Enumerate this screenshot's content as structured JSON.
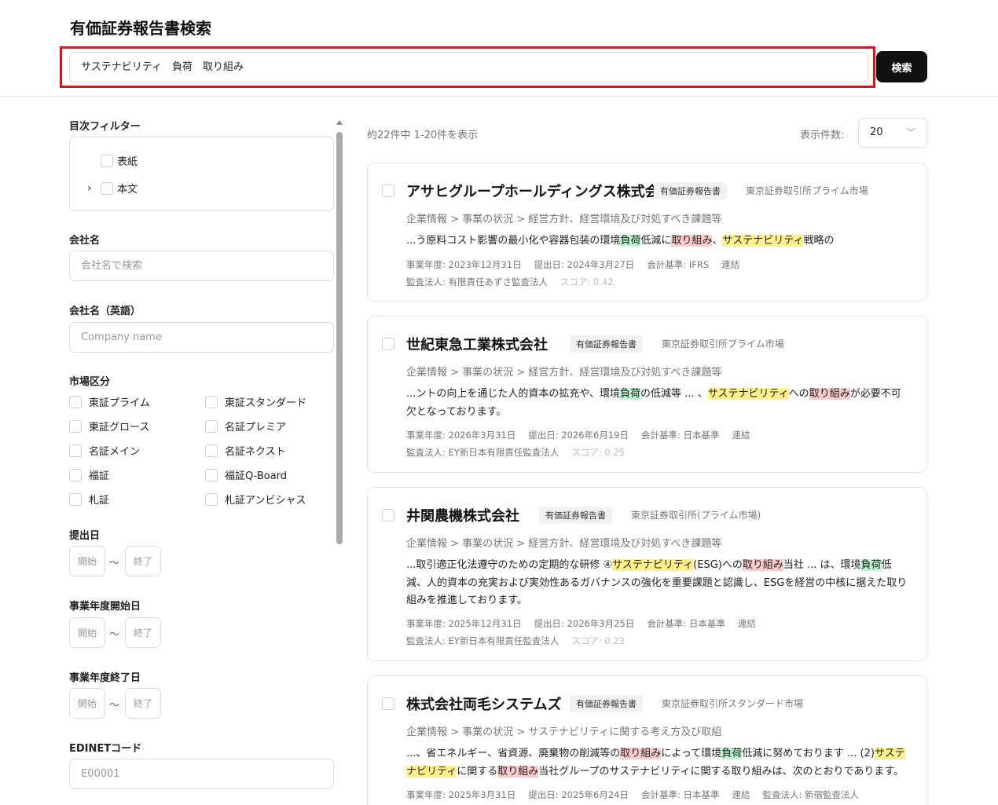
{
  "header": {
    "title": "有価証券報告書検索",
    "search_value": "サステナビリティ　負荷　取り組み",
    "search_button": "検索"
  },
  "sidebar": {
    "toc_filter": {
      "label": "目次フィルター",
      "items": [
        "表紙",
        "本文"
      ]
    },
    "company_name": {
      "label": "会社名",
      "placeholder": "会社名で検索"
    },
    "company_name_en": {
      "label": "会社名（英語）",
      "placeholder": "Company name"
    },
    "market": {
      "label": "市場区分",
      "options": [
        "東証プライム",
        "東証スタンダード",
        "東証グロース",
        "名証プレミア",
        "名証メイン",
        "名証ネクスト",
        "福証",
        "福証Q-Board",
        "札証",
        "札証アンビシャス"
      ]
    },
    "submit_date": {
      "label": "提出日",
      "start": "開始",
      "sep": "〜",
      "end": "終了"
    },
    "fy_start": {
      "label": "事業年度開始日",
      "start": "開始",
      "sep": "〜",
      "end": "終了"
    },
    "fy_end": {
      "label": "事業年度終了日",
      "start": "開始",
      "sep": "〜",
      "end": "終了"
    },
    "edinet": {
      "label": "EDINETコード",
      "placeholder": "E00001"
    }
  },
  "results": {
    "count_text": "約22件中 1-20件を表示",
    "per_page_label": "表示件数:",
    "per_page_value": "20",
    "cards": [
      {
        "name": "アサヒグループホールディングス株式会社",
        "doc_type": "有価証券報告書",
        "market": "東京証券取引所プライム市場",
        "crumb": "企業情報 > 事業の状況 > 経営方針、経営環境及び対処すべき課題等",
        "snippet": [
          [
            "...う原料コスト影響の最小化や容器包装の環境",
            ""
          ],
          [
            "負荷",
            "g"
          ],
          [
            "低減に",
            ""
          ],
          [
            "取り組み",
            "r"
          ],
          [
            "、",
            ""
          ],
          [
            "サステナビリティ",
            "y"
          ],
          [
            "戦略の",
            ""
          ]
        ],
        "fy": "事業年度: 2023年12月31日",
        "submitted": "提出日: 2024年3月27日",
        "standard": "会計基準: IFRS",
        "consolidated": "連結",
        "auditor": "監査法人: 有限責任あずさ監査法人",
        "score": "スコア: 0.42"
      },
      {
        "name": "世紀東急工業株式会社",
        "doc_type": "有価証券報告書",
        "market": "東京証券取引所プライム市場",
        "crumb": "企業情報 > 事業の状況 > 経営方針、経営環境及び対処すべき課題等",
        "snippet": [
          [
            "...ントの向上を通じた人的資本の拡充や、環境",
            ""
          ],
          [
            "負荷",
            "g"
          ],
          [
            "の低減等 ... 、",
            ""
          ],
          [
            "サステナビリティ",
            "y"
          ],
          [
            "への",
            ""
          ],
          [
            "取り組み",
            "r"
          ],
          [
            "が必要不可欠となっております。",
            ""
          ]
        ],
        "fy": "事業年度: 2026年3月31日",
        "submitted": "提出日: 2026年6月19日",
        "standard": "会計基準: 日本基準",
        "consolidated": "連結",
        "auditor": "監査法人: EY新日本有限責任監査法人",
        "score": "スコア: 0.25"
      },
      {
        "name": "井関農機株式会社",
        "doc_type": "有価証券報告書",
        "market": "東京証券取引所(プライム市場)",
        "crumb": "企業情報 > 事業の状況 > 経営方針、経営環境及び対処すべき課題等",
        "snippet": [
          [
            "...取引適正化法遵守のための定期的な研修 ④",
            ""
          ],
          [
            "サステナビリティ",
            "y"
          ],
          [
            "(ESG)への",
            ""
          ],
          [
            "取り組み",
            "r"
          ],
          [
            "当社 ... は、環境",
            ""
          ],
          [
            "負荷",
            "g"
          ],
          [
            "低減、人的資本の充実および実効性あるガバナンスの強化を重要課題と認識し、ESGを経営の中核に据えた取り組みを推進しております。",
            ""
          ]
        ],
        "fy": "事業年度: 2025年12月31日",
        "submitted": "提出日: 2026年3月25日",
        "standard": "会計基準: 日本基準",
        "consolidated": "連結",
        "auditor": "監査法人: EY新日本有限責任監査法人",
        "score": "スコア: 0.23"
      },
      {
        "name": "株式会社両毛システムズ",
        "doc_type": "有価証券報告書",
        "market": "東京証券取引所スタンダード市場",
        "crumb": "企業情報 > 事業の状況 > サステナビリティに関する考え方及び取組",
        "snippet": [
          [
            "...、省エネルギー、省資源、廃棄物の削減等の",
            ""
          ],
          [
            "取り組み",
            "r"
          ],
          [
            "によって環境",
            ""
          ],
          [
            "負荷",
            "g"
          ],
          [
            "低減に努めております ... (2)",
            ""
          ],
          [
            "サステナビリティ",
            "y"
          ],
          [
            "に関する",
            ""
          ],
          [
            "取り組み",
            "r"
          ],
          [
            "当社グループのサステナビリティに関する取り組みは、次のとおりであります。",
            ""
          ]
        ],
        "fy": "事業年度: 2025年3月31日",
        "submitted": "提出日: 2025年6月24日",
        "standard": "会計基準: 日本基準",
        "consolidated": "連結",
        "auditor": "監査法人: 新宿監査法人",
        "score": ""
      }
    ]
  }
}
